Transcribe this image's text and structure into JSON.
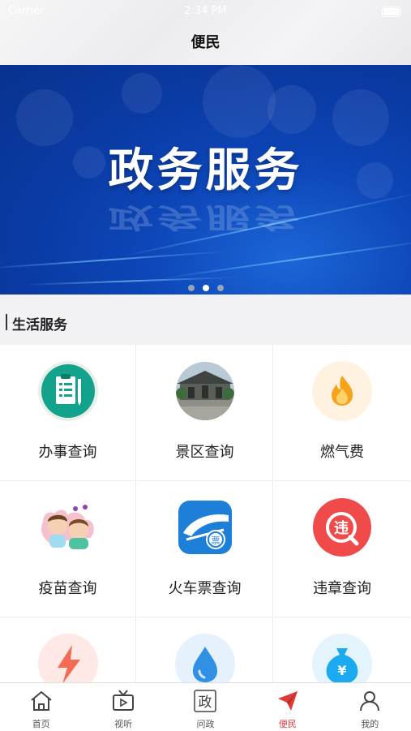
{
  "status_bar": {
    "carrier": "Carrier",
    "time": "2:34 PM"
  },
  "header": {
    "title": "便民"
  },
  "banner": {
    "headline": "政务服务",
    "page_count": 3,
    "active_page": 2
  },
  "section": {
    "title": "生活服务"
  },
  "services": [
    {
      "label": "办事查询",
      "icon": "checklist-icon"
    },
    {
      "label": "景区查询",
      "icon": "scenic-photo-icon"
    },
    {
      "label": "燃气费",
      "icon": "flame-icon"
    },
    {
      "label": "疫苗查询",
      "icon": "vaccine-kids-icon"
    },
    {
      "label": "火车票查询",
      "icon": "train-ticket-icon"
    },
    {
      "label": "违章查询",
      "icon": "violation-icon"
    },
    {
      "label": "",
      "icon": "lightning-icon"
    },
    {
      "label": "",
      "icon": "water-drop-icon"
    },
    {
      "label": "",
      "icon": "money-bag-icon"
    }
  ],
  "tabs": [
    {
      "label": "首页",
      "icon": "home-icon"
    },
    {
      "label": "视听",
      "icon": "tv-icon"
    },
    {
      "label": "问政",
      "icon": "zheng-icon",
      "glyph": "政"
    },
    {
      "label": "便民",
      "icon": "paper-plane-icon",
      "active": true
    },
    {
      "label": "我的",
      "icon": "user-icon"
    }
  ],
  "colors": {
    "accent": "#e03a3a",
    "banner_blue": "#0d46b8"
  }
}
